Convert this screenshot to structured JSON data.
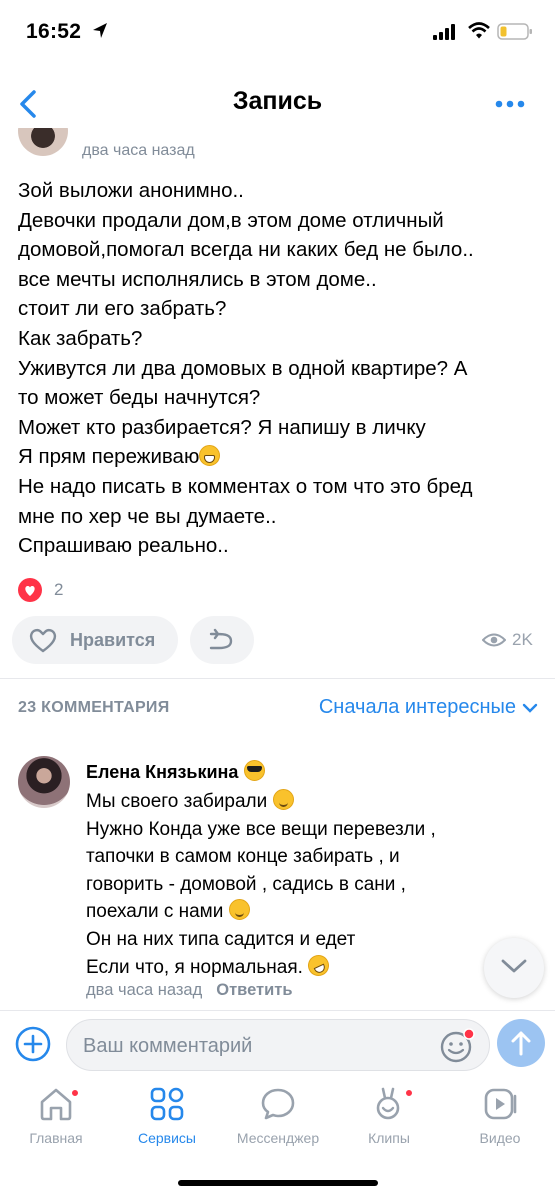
{
  "status_bar": {
    "time": "16:52"
  },
  "header": {
    "title": "Запись"
  },
  "post": {
    "time": "два часа назад",
    "lines": [
      "Зой выложи анонимно..",
      "Девочки продали дом,в этом доме отличный",
      "домовой,помогал всегда ни каких бед не было..",
      "все мечты исполнялись в этом доме..",
      "стоит ли его забрать?",
      "Как забрать?",
      "Уживутся ли два домовых в одной квартире? А",
      "то может беды начнутся?",
      "Может кто разбирается? Я напишу в личку",
      "Я прям переживаю",
      "Не надо писать в комментах о том что это бред",
      "мне по хер че вы думаете..",
      "Спрашиваю реально.."
    ],
    "reactions_count": "2",
    "like_label": "Нравится",
    "views": "2K"
  },
  "comments": {
    "count_label": "23 КОММЕНТАРИЯ",
    "sort_label": "Сначала интересные",
    "items": [
      {
        "author": "Елена Князькина",
        "lines": [
          "Мы своего забирали",
          "Нужно Конда уже все вещи перевезли ,",
          "тапочки в самом конце забирать , и",
          "говорить - домовой , садись в сани ,",
          "поехали с нами",
          "Он на них типа садится и едет",
          "Если что, я нормальная."
        ],
        "time": "два часа назад",
        "reply_label": "Ответить"
      }
    ]
  },
  "composer": {
    "placeholder": "Ваш комментарий"
  },
  "tabbar": {
    "items": [
      {
        "label": "Главная",
        "active": false,
        "badge": true
      },
      {
        "label": "Сервисы",
        "active": true,
        "badge": false
      },
      {
        "label": "Мессенджер",
        "active": false,
        "badge": false
      },
      {
        "label": "Клипы",
        "active": false,
        "badge": true
      },
      {
        "label": "Видео",
        "active": false,
        "badge": false
      }
    ]
  },
  "colors": {
    "accent": "#2688eb",
    "secondary_text": "#818c99",
    "badge": "#ff3347"
  }
}
